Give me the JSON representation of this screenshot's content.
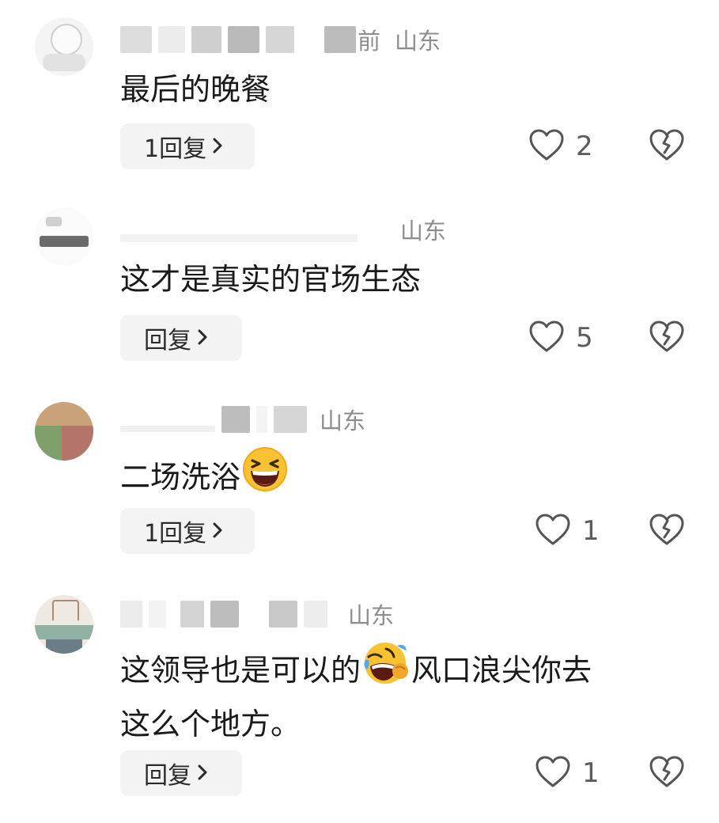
{
  "comments": [
    {
      "time_suffix": "前",
      "location": "山东",
      "text": "最后的晚餐",
      "reply_label": "1回复",
      "like_count": "2"
    },
    {
      "location": "山东",
      "text": "这才是真实的官场生态",
      "reply_label": "回复",
      "like_count": "5"
    },
    {
      "location": "山东",
      "text": "二场洗浴",
      "emoji": "laughing-face",
      "reply_label": "1回复",
      "like_count": "1"
    },
    {
      "location": "山东",
      "text_line1_a": "这领导也是可以的",
      "emoji": "rolling-on-floor-laughing-face",
      "text_line1_b": "风口浪尖你去",
      "text_line2": "这么个地方。",
      "reply_label": "回复",
      "like_count": "1"
    }
  ],
  "icons": {
    "like": "heart-outline-icon",
    "dislike": "broken-heart-icon",
    "reply_arrow": "chevron-right-icon"
  },
  "colors": {
    "reply_button_bg": "#f3f3f3",
    "location_text": "#8d8d8d",
    "icon_stroke": "#555555"
  }
}
